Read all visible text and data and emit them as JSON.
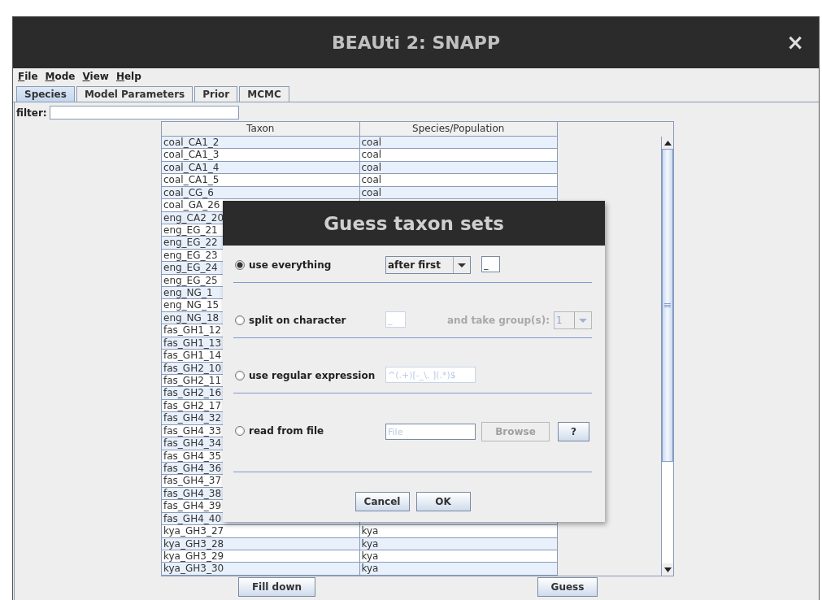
{
  "window": {
    "title": "BEAUti 2: SNAPP",
    "close": "×"
  },
  "menu": [
    "File",
    "Mode",
    "View",
    "Help"
  ],
  "tabs": [
    {
      "label": "Species",
      "selected": true
    },
    {
      "label": "Model Parameters",
      "selected": false
    },
    {
      "label": "Prior",
      "selected": false
    },
    {
      "label": "MCMC",
      "selected": false
    }
  ],
  "filter": {
    "label": "filter:"
  },
  "table": {
    "columns": [
      "Taxon",
      "Species/Population"
    ],
    "rows": [
      {
        "taxon": "coal_CA1_2",
        "species": "coal"
      },
      {
        "taxon": "coal_CA1_3",
        "species": "coal"
      },
      {
        "taxon": "coal_CA1_4",
        "species": "coal"
      },
      {
        "taxon": "coal_CA1_5",
        "species": "coal"
      },
      {
        "taxon": "coal_CG_6",
        "species": "coal"
      },
      {
        "taxon": "coal_GA_26"
      },
      {
        "taxon": "eng_CA2_20"
      },
      {
        "taxon": "eng_EG_21"
      },
      {
        "taxon": "eng_EG_22"
      },
      {
        "taxon": "eng_EG_23"
      },
      {
        "taxon": "eng_EG_24"
      },
      {
        "taxon": "eng_EG_25"
      },
      {
        "taxon": "eng_NG_1"
      },
      {
        "taxon": "eng_NG_15"
      },
      {
        "taxon": "eng_NG_18"
      },
      {
        "taxon": "fas_GH1_12"
      },
      {
        "taxon": "fas_GH1_13"
      },
      {
        "taxon": "fas_GH1_14"
      },
      {
        "taxon": "fas_GH2_10"
      },
      {
        "taxon": "fas_GH2_11"
      },
      {
        "taxon": "fas_GH2_16"
      },
      {
        "taxon": "fas_GH2_17"
      },
      {
        "taxon": "fas_GH4_32"
      },
      {
        "taxon": "fas_GH4_33"
      },
      {
        "taxon": "fas_GH4_34"
      },
      {
        "taxon": "fas_GH4_35"
      },
      {
        "taxon": "fas_GH4_36"
      },
      {
        "taxon": "fas_GH4_37"
      },
      {
        "taxon": "fas_GH4_38"
      },
      {
        "taxon": "fas_GH4_39"
      },
      {
        "taxon": "fas_GH4_40"
      },
      {
        "taxon": "kya_GH3_27",
        "species": "kya"
      },
      {
        "taxon": "kya_GH3_28",
        "species": "kya"
      },
      {
        "taxon": "kya_GH3_29",
        "species": "kya"
      },
      {
        "taxon": "kya_GH3_30",
        "species": "kya"
      }
    ]
  },
  "buttons": [
    "Fill down",
    "Guess"
  ],
  "dialog": {
    "title": "Guess taxon sets",
    "options": [
      {
        "kind": "everything",
        "label": "use everything",
        "selected": true,
        "dropdown": "after first",
        "field": "_"
      },
      {
        "kind": "split",
        "label": "split on character",
        "selected": false,
        "field": "_",
        "group_label": "and take group(s):",
        "group_dropdown": "1",
        "disabled": true
      },
      {
        "kind": "regex",
        "label": "use regular expression",
        "selected": false,
        "field": "^(.+)[-_\\. ](.*)$",
        "disabled": true
      },
      {
        "kind": "file",
        "label": "read from file",
        "selected": false,
        "placeholder": "File",
        "browse": "Browse",
        "help": "?",
        "disabled": true
      }
    ],
    "buttons": [
      "Cancel",
      "OK"
    ]
  }
}
